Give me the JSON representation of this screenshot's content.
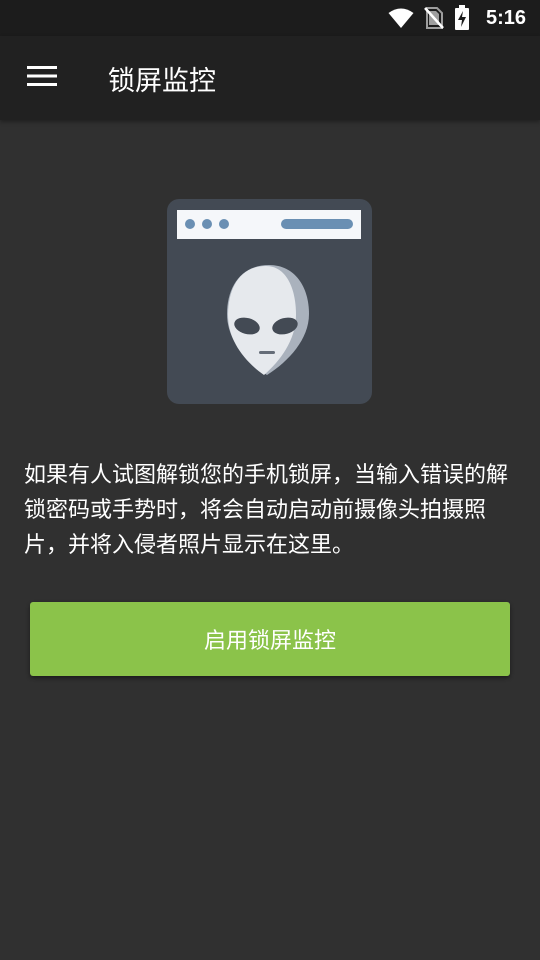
{
  "status_bar": {
    "time": "5:16",
    "icons": [
      "wifi-icon",
      "no-sim-icon",
      "battery-charging-icon"
    ]
  },
  "toolbar": {
    "menu_icon": "menu-icon",
    "title": "锁屏监控"
  },
  "hero": {
    "icon": "alien-browser-illustration"
  },
  "main": {
    "description": "如果有人试图解锁您的手机锁屏，当输入错误的解锁密码或手势时，将会自动启动前摄像头拍摄照片，并将入侵者照片显示在这里。",
    "enable_button_label": "启用锁屏监控"
  },
  "colors": {
    "background": "#303030",
    "toolbar": "#212121",
    "status_bar": "#1c1c1c",
    "accent_button": "#8bc34a"
  }
}
